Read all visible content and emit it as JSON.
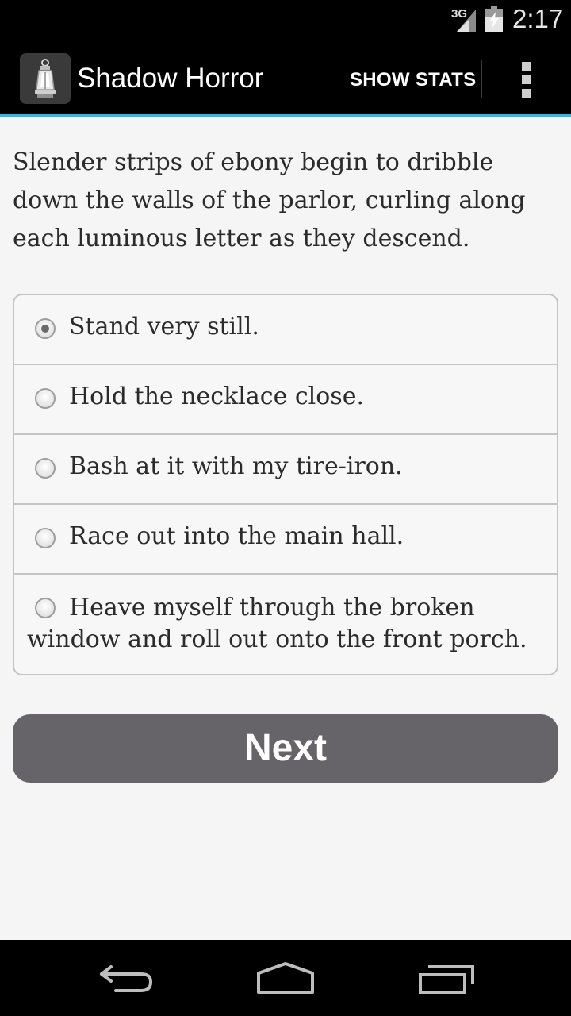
{
  "status_bar": {
    "network": "3G",
    "time": "2:17"
  },
  "action_bar": {
    "title": "Shadow Horror",
    "show_stats_label": "SHOW STATS",
    "accent_color": "#33b5e5"
  },
  "story": {
    "text": "Slender strips of ebony begin to dribble down the walls of the parlor, curling along each luminous letter as they descend."
  },
  "choices": [
    {
      "label": "Stand very still.",
      "selected": true
    },
    {
      "label": "Hold the necklace close.",
      "selected": false
    },
    {
      "label": "Bash at it with my tire-iron.",
      "selected": false
    },
    {
      "label": "Race out into the main hall.",
      "selected": false
    },
    {
      "label": "Heave myself through the broken window and roll out onto the front porch.",
      "selected": false
    }
  ],
  "next_button": {
    "label": "Next",
    "color": "#666468"
  },
  "icons": {
    "app": "lantern-icon",
    "overflow": "overflow-menu-icon",
    "back": "back-icon",
    "home": "home-icon",
    "recents": "recents-icon"
  }
}
